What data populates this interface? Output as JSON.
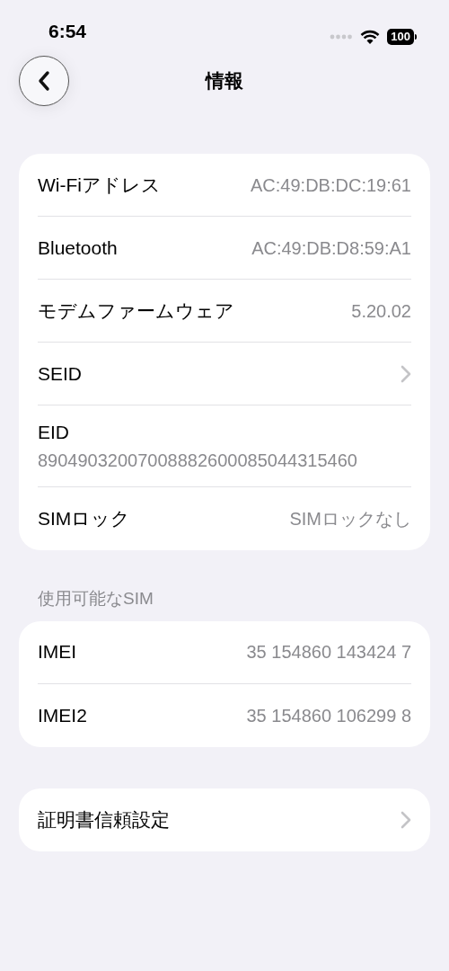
{
  "status_bar": {
    "time": "6:54",
    "battery": "100"
  },
  "nav": {
    "title": "情報"
  },
  "sections": [
    {
      "rows": [
        {
          "kind": "value",
          "label": "Wi-Fiアドレス",
          "value": "AC:49:DB:DC:19:61"
        },
        {
          "kind": "value",
          "label": "Bluetooth",
          "value": "AC:49:DB:D8:59:A1"
        },
        {
          "kind": "value",
          "label": "モデムファームウェア",
          "value": "5.20.02"
        },
        {
          "kind": "chevron",
          "label": "SEID"
        },
        {
          "kind": "stacked",
          "label": "EID",
          "value": "89049032007008882600085044315460"
        },
        {
          "kind": "value",
          "label": "SIMロック",
          "value": "SIMロックなし"
        }
      ]
    },
    {
      "header": "使用可能なSIM",
      "rows": [
        {
          "kind": "value",
          "label": "IMEI",
          "value": "35 154860 143424 7"
        },
        {
          "kind": "value",
          "label": "IMEI2",
          "value": "35 154860 106299 8"
        }
      ]
    },
    {
      "rows": [
        {
          "kind": "chevron",
          "label": "証明書信頼設定"
        }
      ]
    }
  ]
}
